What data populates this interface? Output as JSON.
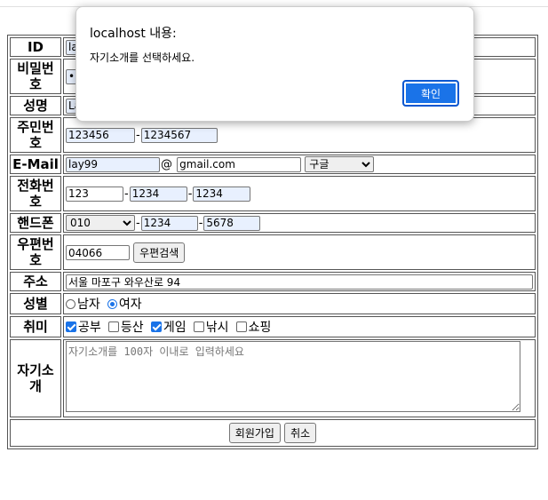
{
  "form": {
    "id": {
      "label": "ID",
      "value": "lay99"
    },
    "password": {
      "label": "비밀번호",
      "value": "••••••••••"
    },
    "name": {
      "label": "성명",
      "value": "Lay"
    },
    "jumin": {
      "label": "주민번호",
      "front": "123456",
      "back": "1234567",
      "sep": "-"
    },
    "email": {
      "label": "E-Mail",
      "user": "lay99",
      "at": "@",
      "domain": "gmail.com",
      "select": "구글"
    },
    "phone": {
      "label": "전화번호",
      "p1": "123",
      "p2": "1234",
      "p3": "1234",
      "sep": "-"
    },
    "mobile": {
      "label": "핸드폰",
      "carrier": "010",
      "p2": "1234",
      "p3": "5678",
      "sep": "-"
    },
    "zip": {
      "label": "우편번호",
      "value": "04066",
      "button": "우편검색"
    },
    "address": {
      "label": "주소",
      "value": "서울 마포구 와우산로 94"
    },
    "gender": {
      "label": "성별",
      "male": "남자",
      "female": "여자",
      "selected": "female"
    },
    "hobby": {
      "label": "취미",
      "items": [
        {
          "label": "공부",
          "checked": true
        },
        {
          "label": "등산",
          "checked": false
        },
        {
          "label": "게임",
          "checked": true
        },
        {
          "label": "낚시",
          "checked": false
        },
        {
          "label": "쇼핑",
          "checked": false
        }
      ]
    },
    "intro": {
      "label": "자기소개",
      "placeholder": "자기소개를 100자 이내로 입력하세요"
    },
    "submit": "회원가입",
    "cancel": "취소"
  },
  "dialog": {
    "title": "localhost 내용:",
    "message": "자기소개를 선택하세요.",
    "ok": "확인"
  },
  "colors": {
    "accent": "#1a73e8",
    "autofill": "#e8f0fe"
  }
}
